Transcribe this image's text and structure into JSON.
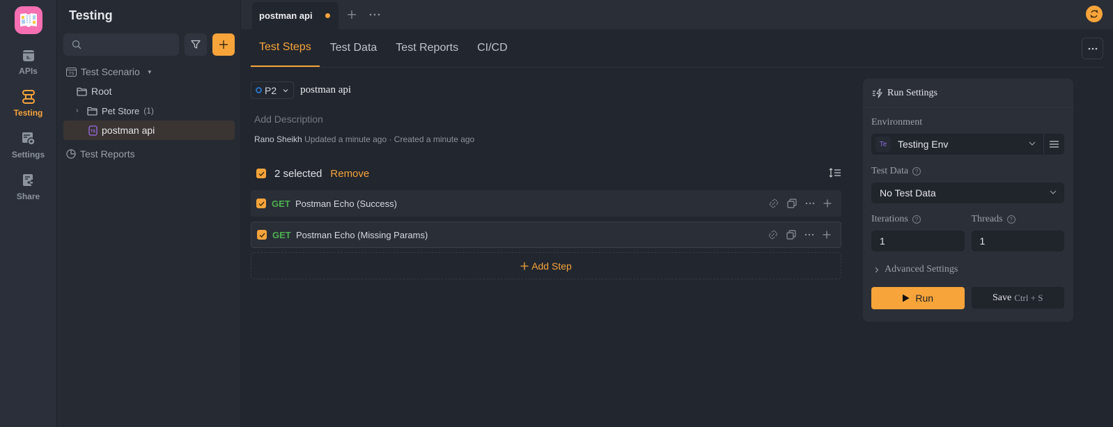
{
  "rail": {
    "items": [
      {
        "label": "APIs",
        "icon": "apis-icon"
      },
      {
        "label": "Testing",
        "icon": "testing-icon",
        "active": true
      },
      {
        "label": "Settings",
        "icon": "settings-icon"
      },
      {
        "label": "Share",
        "icon": "share-icon"
      }
    ]
  },
  "sidebar": {
    "title": "Testing",
    "search_placeholder": "",
    "tree": {
      "section_scenario": "Test Scenario",
      "root": "Root",
      "folder": "Pet Store",
      "folder_count": "(1)",
      "scenario": "postman api",
      "section_reports": "Test Reports"
    }
  },
  "tabbar": {
    "tab_label": "postman api",
    "unsaved": true
  },
  "subtabs": [
    "Test Steps",
    "Test Data",
    "Test Reports",
    "CI/CD"
  ],
  "scenario": {
    "priority": "P2",
    "name": "postman api",
    "description_placeholder": "Add Description",
    "author": "Rano Sheikh",
    "meta": "Updated a minute ago · Created a minute ago"
  },
  "selection": {
    "text": "2 selected",
    "remove_label": "Remove"
  },
  "steps": [
    {
      "method": "GET",
      "name": "Postman Echo (Success)",
      "checked": true
    },
    {
      "method": "GET",
      "name": "Postman Echo (Missing Params)",
      "checked": true
    }
  ],
  "add_step_label": "Add Step",
  "run_settings": {
    "title": "Run Settings",
    "environment_label": "Environment",
    "environment_badge": "Te",
    "environment_value": "Testing Env",
    "test_data_label": "Test Data",
    "test_data_value": "No Test Data",
    "iterations_label": "Iterations",
    "iterations_value": "1",
    "threads_label": "Threads",
    "threads_value": "1",
    "advanced_label": "Advanced Settings",
    "run_label": "Run",
    "save_label": "Save",
    "save_shortcut": "Ctrl + S"
  },
  "colors": {
    "accent": "#f7a43b",
    "method_get": "#4caf50",
    "background": "#22262e"
  }
}
